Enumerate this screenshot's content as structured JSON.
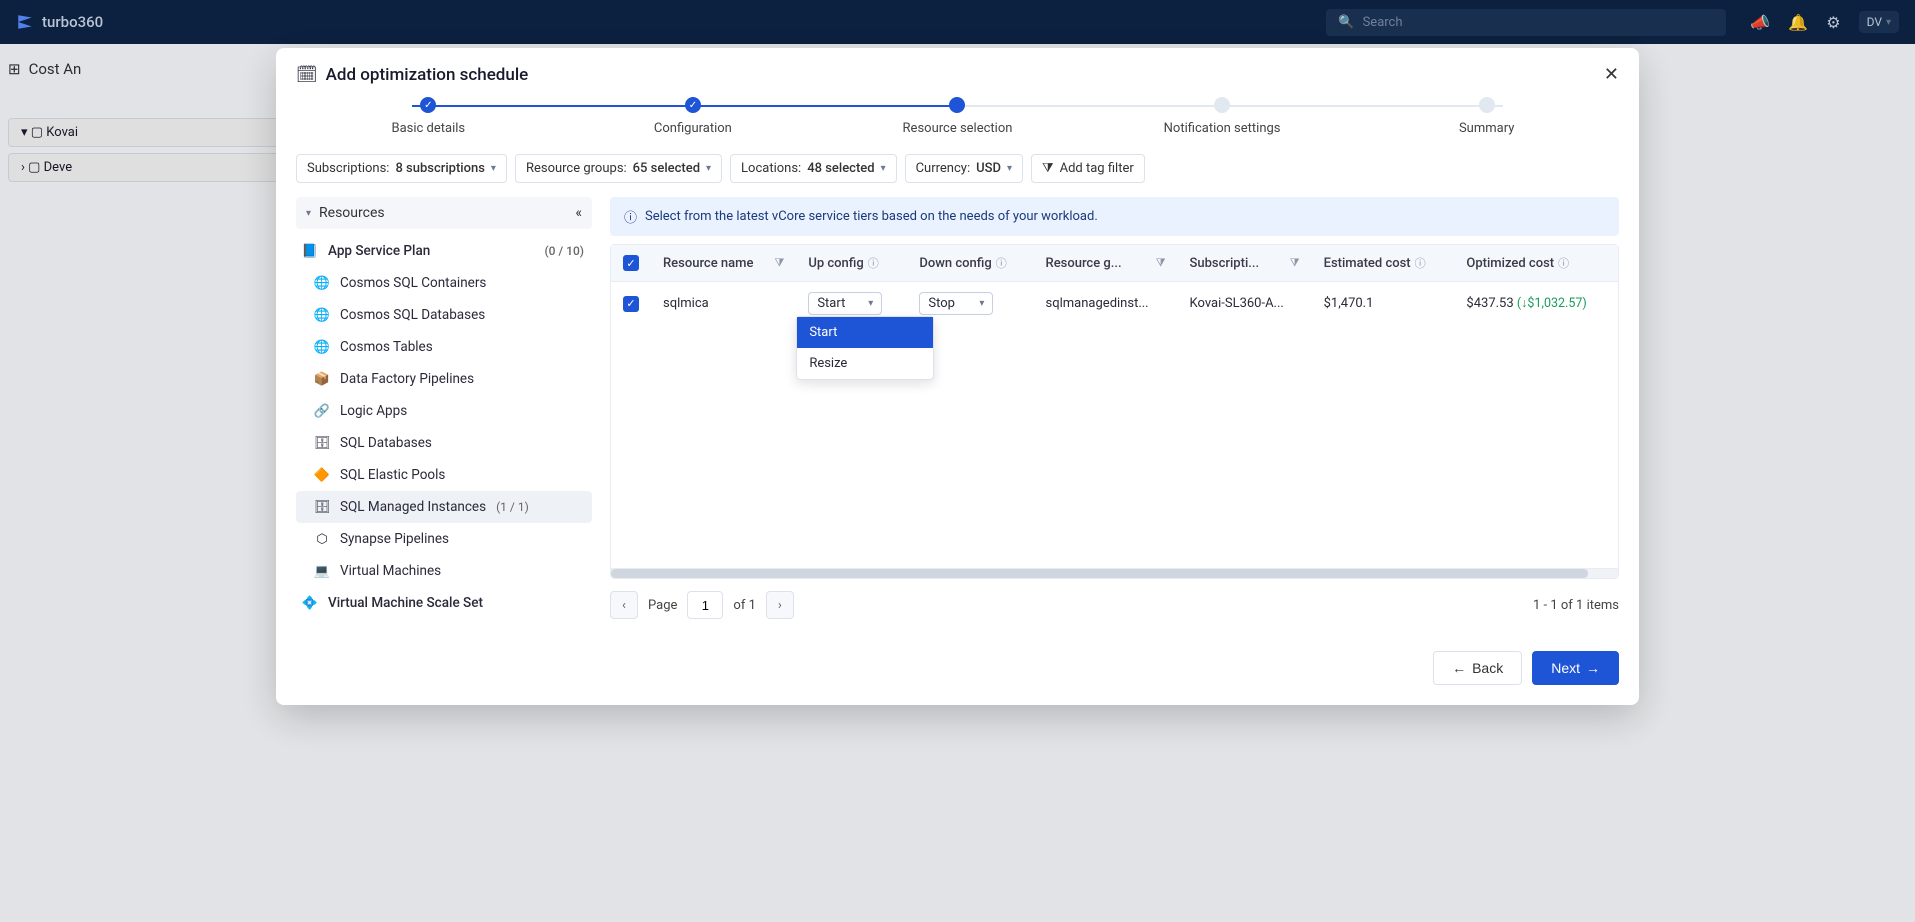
{
  "brand": "turbo360",
  "search_placeholder": "Search",
  "user_badge": "DV",
  "breadcrumb": "Cost An",
  "bg_items": [
    "Kovai",
    "Deve"
  ],
  "modal": {
    "title": "Add optimization schedule",
    "steps": [
      "Basic details",
      "Configuration",
      "Resource selection",
      "Notification settings",
      "Summary"
    ],
    "filters": {
      "subs_label": "Subscriptions:",
      "subs_value": "8 subscriptions",
      "rg_label": "Resource groups:",
      "rg_value": "65 selected",
      "loc_label": "Locations:",
      "loc_value": "48 selected",
      "cur_label": "Currency:",
      "cur_value": "USD",
      "tag_label": "Add tag filter"
    },
    "resources_header": "Resources",
    "resources": [
      {
        "label": "App Service Plan",
        "count": "(0 / 10)",
        "icon": "📘",
        "group": true
      },
      {
        "label": "Cosmos SQL Containers",
        "icon": "🌐"
      },
      {
        "label": "Cosmos SQL Databases",
        "icon": "🌐"
      },
      {
        "label": "Cosmos Tables",
        "icon": "🌐"
      },
      {
        "label": "Data Factory Pipelines",
        "icon": "📦"
      },
      {
        "label": "Logic Apps",
        "icon": "🔗"
      },
      {
        "label": "SQL Databases",
        "icon": "🗄"
      },
      {
        "label": "SQL Elastic Pools",
        "icon": "🔶"
      },
      {
        "label": "SQL Managed Instances",
        "count": "(1 / 1)",
        "icon": "🗄",
        "selected": true
      },
      {
        "label": "Synapse Pipelines",
        "icon": "⬡"
      },
      {
        "label": "Virtual Machines",
        "icon": "💻"
      },
      {
        "label": "Virtual Machine Scale Set",
        "icon": "💠",
        "group": true
      }
    ],
    "banner": "Select from the latest vCore service tiers based on the needs of your workload.",
    "columns": {
      "resource": "Resource name",
      "up": "Up config",
      "down": "Down config",
      "rg": "Resource g...",
      "sub": "Subscripti...",
      "est": "Estimated cost",
      "opt": "Optimized cost"
    },
    "row": {
      "name": "sqlmica",
      "up": "Start",
      "down": "Stop",
      "rg": "sqlmanagedinst...",
      "sub": "Kovai-SL360-A...",
      "est": "$1,470.1",
      "opt": "$437.53",
      "savings": "(↓$1,032.57)"
    },
    "dropdown_options": [
      "Start",
      "Resize"
    ],
    "pagination": {
      "page_label": "Page",
      "page": "1",
      "of_label": "of 1",
      "range": "1 - 1 of 1 items"
    },
    "back": "Back",
    "next": "Next"
  }
}
